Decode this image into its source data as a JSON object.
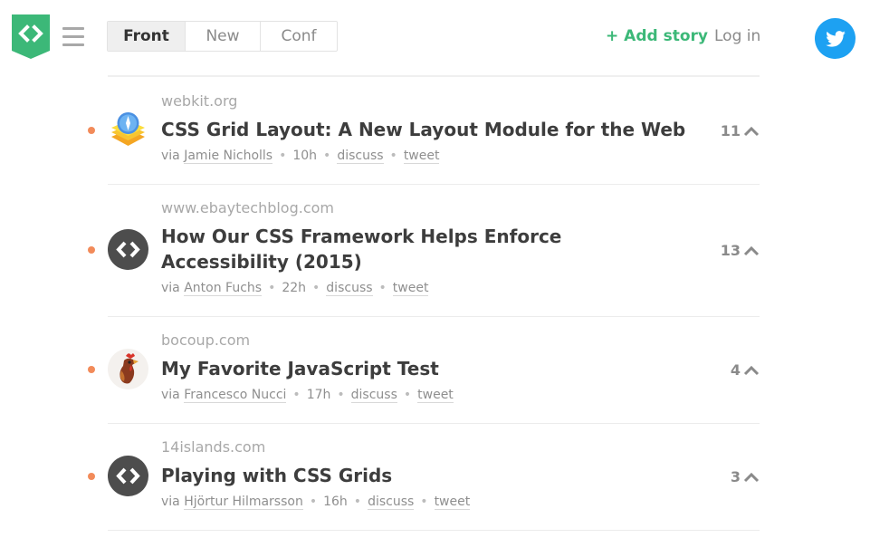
{
  "header": {
    "tabs": [
      {
        "label": "Front"
      },
      {
        "label": "New"
      },
      {
        "label": "Conf"
      }
    ],
    "add_story_label": "+ Add story",
    "login_label": "Log in"
  },
  "stories": [
    {
      "domain": "webkit.org",
      "title": "CSS Grid Layout: A New Layout Module for the Web",
      "via": "via",
      "author": "Jamie Nicholls",
      "age": "10h",
      "discuss": "discuss",
      "tweet": "tweet",
      "votes": "11",
      "avatar": "webkit-icon"
    },
    {
      "domain": "www.ebaytechblog.com",
      "title": "How Our CSS Framework Helps Enforce Accessibility (2015)",
      "via": "via",
      "author": "Anton Fuchs",
      "age": "22h",
      "discuss": "discuss",
      "tweet": "tweet",
      "votes": "13",
      "avatar": "code-brackets-icon"
    },
    {
      "domain": "bocoup.com",
      "title": "My Favorite JavaScript Test",
      "via": "via",
      "author": "Francesco Nucci",
      "age": "17h",
      "discuss": "discuss",
      "tweet": "tweet",
      "votes": "4",
      "avatar": "rooster-icon"
    },
    {
      "domain": "14islands.com",
      "title": "Playing with CSS Grids",
      "via": "via",
      "author": "Hjörtur Hilmarsson",
      "age": "16h",
      "discuss": "discuss",
      "tweet": "tweet",
      "votes": "3",
      "avatar": "code-brackets-icon"
    }
  ],
  "colors": {
    "brand_green": "#3cb878",
    "twitter_blue": "#1da1f2",
    "new_dot": "#f28b5a"
  }
}
